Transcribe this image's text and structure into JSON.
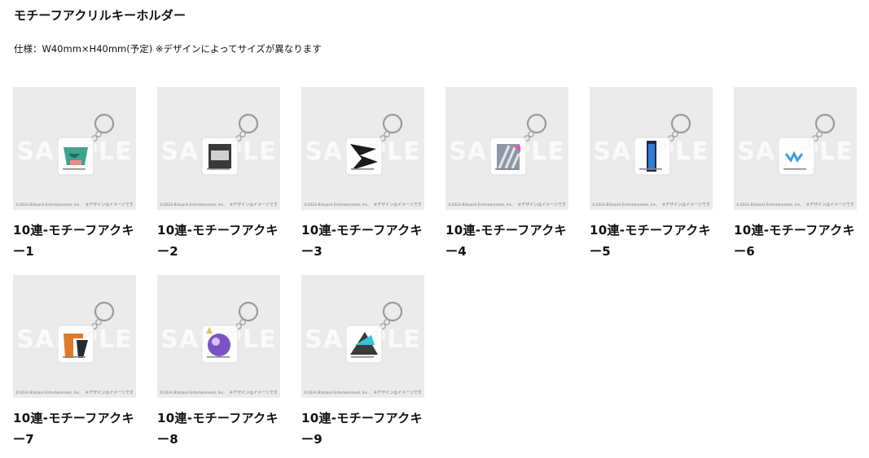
{
  "header": {
    "title": "モチーフアクリルキーホルダー",
    "spec": "仕様：W40mm×H40mm(予定) ※デザインによってサイズが異なります"
  },
  "thumb": {
    "watermark": "SAMPLE",
    "copyright": "©2024 Blizzard Entertainment, Inc.",
    "note": "※デザインはイメージです"
  },
  "products": [
    {
      "title": "10連-モチーフアクキー1",
      "icon": "green-tusk-emblem-icon",
      "color": "#3fa38f"
    },
    {
      "title": "10連-モチーフアクキー2",
      "icon": "black-nameplate-emblem-icon",
      "color": "#3a3a3a"
    },
    {
      "title": "10連-モチーフアクキー3",
      "icon": "black-geometric-emblem-icon",
      "color": "#1b1b1b"
    },
    {
      "title": "10連-モチーフアクキー4",
      "icon": "striped-tile-emblem-icon",
      "color": "#8f97a6"
    },
    {
      "title": "10連-モチーフアクキー5",
      "icon": "blue-vertical-tag-emblem-icon",
      "color": "#2d7ed0"
    },
    {
      "title": "10連-モチーフアクキー6",
      "icon": "small-blue-logo-emblem-icon",
      "color": "#3b9fd8"
    },
    {
      "title": "10連-モチーフアクキー7",
      "icon": "orange-letter-emblem-icon",
      "color": "#e07a2b"
    },
    {
      "title": "10連-モチーフアクキー8",
      "icon": "purple-orb-emblem-icon",
      "color": "#7a53c4"
    },
    {
      "title": "10連-モチーフアクキー9",
      "icon": "cyan-dark-angular-emblem-icon",
      "color": "#39c2d6"
    }
  ]
}
